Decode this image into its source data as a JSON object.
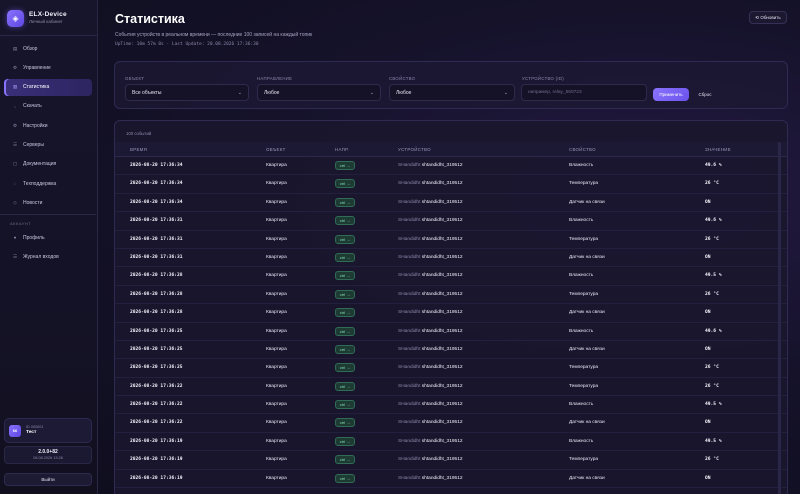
{
  "brand": {
    "logo_glyph": "◈",
    "name": "ELX-Device",
    "subtitle": "Личный кабинет"
  },
  "sidebar": {
    "items": [
      {
        "icon": "grid-icon",
        "glyph": "▤",
        "label": "Обзор",
        "active": false
      },
      {
        "icon": "sliders-icon",
        "glyph": "⚙",
        "label": "Управление",
        "active": false
      },
      {
        "icon": "chart-icon",
        "glyph": "▥",
        "label": "Статистика",
        "active": true
      },
      {
        "icon": "download-icon",
        "glyph": "↓",
        "label": "Скачать",
        "active": false
      },
      {
        "icon": "gear-icon",
        "glyph": "⚙",
        "label": "Настройки",
        "active": false
      },
      {
        "icon": "server-icon",
        "glyph": "☰",
        "label": "Серверы",
        "active": false
      },
      {
        "icon": "document-icon",
        "glyph": "▢",
        "label": "Документация",
        "active": false
      },
      {
        "icon": "support-icon",
        "glyph": "◌",
        "label": "Техподдержка",
        "active": false
      },
      {
        "icon": "news-icon",
        "glyph": "◇",
        "label": "Новости",
        "active": false
      }
    ],
    "account_section": "АККАУНТ",
    "account_items": [
      {
        "icon": "profile-icon",
        "glyph": "●",
        "label": "Профиль"
      },
      {
        "icon": "log-icon",
        "glyph": "☰",
        "label": "Журнал входов"
      }
    ],
    "user": {
      "avatar": "66",
      "id": "ID 000001",
      "name": "Тест"
    },
    "version": {
      "number": "2.0.0+82",
      "date": "06.08.2026 13:28"
    },
    "logout_label": "Выйти"
  },
  "header": {
    "title": "Статистика",
    "subtitle": "События устройств в реальном времени — последние 100 записей на каждый топик",
    "meta": "UpTime: 10m 57m 0s · Last Update: 20.08.2026 17:36:30",
    "refresh_label": "⟲ Обновить"
  },
  "filters": {
    "object": {
      "label": "ОБЪЕКТ",
      "value": "Все объекты"
    },
    "direction": {
      "label": "НАПРАВЛЕНИЕ",
      "value": "Любое"
    },
    "property": {
      "label": "СВОЙСТВО",
      "value": "Любое"
    },
    "device": {
      "label": "УСТРОЙСТВО (ID)",
      "placeholder": "например, relay_560723"
    },
    "apply_label": "Применить",
    "reset_label": "Сброс"
  },
  "events": {
    "count_label": "100 событий",
    "columns": [
      "ВРЕМЯ",
      "ОБЪЕКТ",
      "НАПР.",
      "УСТРОЙСТВО",
      "СВОЙСТВО",
      "ЗНАЧЕНИЕ"
    ],
    "rows": [
      {
        "time": "2026-08-20 17:36:34",
        "object": "Квартира",
        "dir": "ctrl →",
        "device_brand": "SHandidht",
        "device_id": "shtandidht_319512",
        "property": "Влажность",
        "value": "49.6 %"
      },
      {
        "time": "2026-08-20 17:36:34",
        "object": "Квартира",
        "dir": "ctrl →",
        "device_brand": "SHandidht",
        "device_id": "shtandidht_319512",
        "property": "Температура",
        "value": "26 °C"
      },
      {
        "time": "2026-08-20 17:36:34",
        "object": "Квартира",
        "dir": "ctrl →",
        "device_brand": "SHandidht",
        "device_id": "shtandidht_319512",
        "property": "Датчик на связи",
        "value": "ON"
      },
      {
        "time": "2026-08-20 17:36:31",
        "object": "Квартира",
        "dir": "ctrl →",
        "device_brand": "SHandidht",
        "device_id": "shtandidht_319512",
        "property": "Влажность",
        "value": "49.6 %"
      },
      {
        "time": "2026-08-20 17:36:31",
        "object": "Квартира",
        "dir": "ctrl →",
        "device_brand": "SHandidht",
        "device_id": "shtandidht_319512",
        "property": "Температура",
        "value": "26 °C"
      },
      {
        "time": "2026-08-20 17:36:31",
        "object": "Квартира",
        "dir": "ctrl →",
        "device_brand": "SHandidht",
        "device_id": "shtandidht_319512",
        "property": "Датчик на связи",
        "value": "ON"
      },
      {
        "time": "2026-08-20 17:36:28",
        "object": "Квартира",
        "dir": "ctrl →",
        "device_brand": "SHandidht",
        "device_id": "shtandidht_319512",
        "property": "Влажность",
        "value": "49.5 %"
      },
      {
        "time": "2026-08-20 17:36:28",
        "object": "Квартира",
        "dir": "ctrl →",
        "device_brand": "SHandidht",
        "device_id": "shtandidht_319512",
        "property": "Температура",
        "value": "26 °C"
      },
      {
        "time": "2026-08-20 17:36:28",
        "object": "Квартира",
        "dir": "ctrl →",
        "device_brand": "SHandidht",
        "device_id": "shtandidht_319512",
        "property": "Датчик на связи",
        "value": "ON"
      },
      {
        "time": "2026-08-20 17:36:25",
        "object": "Квартира",
        "dir": "ctrl →",
        "device_brand": "SHandidht",
        "device_id": "shtandidht_319512",
        "property": "Влажность",
        "value": "49.6 %"
      },
      {
        "time": "2026-08-20 17:36:25",
        "object": "Квартира",
        "dir": "ctrl →",
        "device_brand": "SHandidht",
        "device_id": "shtandidht_319512",
        "property": "Датчик на связи",
        "value": "ON"
      },
      {
        "time": "2026-08-20 17:36:25",
        "object": "Квартира",
        "dir": "ctrl →",
        "device_brand": "SHandidht",
        "device_id": "shtandidht_319512",
        "property": "Температура",
        "value": "26 °C"
      },
      {
        "time": "2026-08-20 17:36:22",
        "object": "Квартира",
        "dir": "ctrl →",
        "device_brand": "SHandidht",
        "device_id": "shtandidht_319512",
        "property": "Температура",
        "value": "26 °C"
      },
      {
        "time": "2026-08-20 17:36:22",
        "object": "Квартира",
        "dir": "ctrl →",
        "device_brand": "SHandidht",
        "device_id": "shtandidht_319512",
        "property": "Влажность",
        "value": "49.5 %"
      },
      {
        "time": "2026-08-20 17:36:22",
        "object": "Квартира",
        "dir": "ctrl →",
        "device_brand": "SHandidht",
        "device_id": "shtandidht_319512",
        "property": "Датчик на связи",
        "value": "ON"
      },
      {
        "time": "2026-08-20 17:36:19",
        "object": "Квартира",
        "dir": "ctrl →",
        "device_brand": "SHandidht",
        "device_id": "shtandidht_319512",
        "property": "Влажность",
        "value": "49.5 %"
      },
      {
        "time": "2026-08-20 17:36:19",
        "object": "Квартира",
        "dir": "ctrl →",
        "device_brand": "SHandidht",
        "device_id": "shtandidht_319512",
        "property": "Температура",
        "value": "26 °C"
      },
      {
        "time": "2026-08-20 17:36:19",
        "object": "Квартира",
        "dir": "ctrl →",
        "device_brand": "SHandidht",
        "device_id": "shtandidht_319512",
        "property": "Датчик на связи",
        "value": "ON"
      }
    ]
  },
  "colors": {
    "accent": "#8a73ff",
    "background": "#15122a",
    "direction_badge": "#7fe0b0"
  }
}
